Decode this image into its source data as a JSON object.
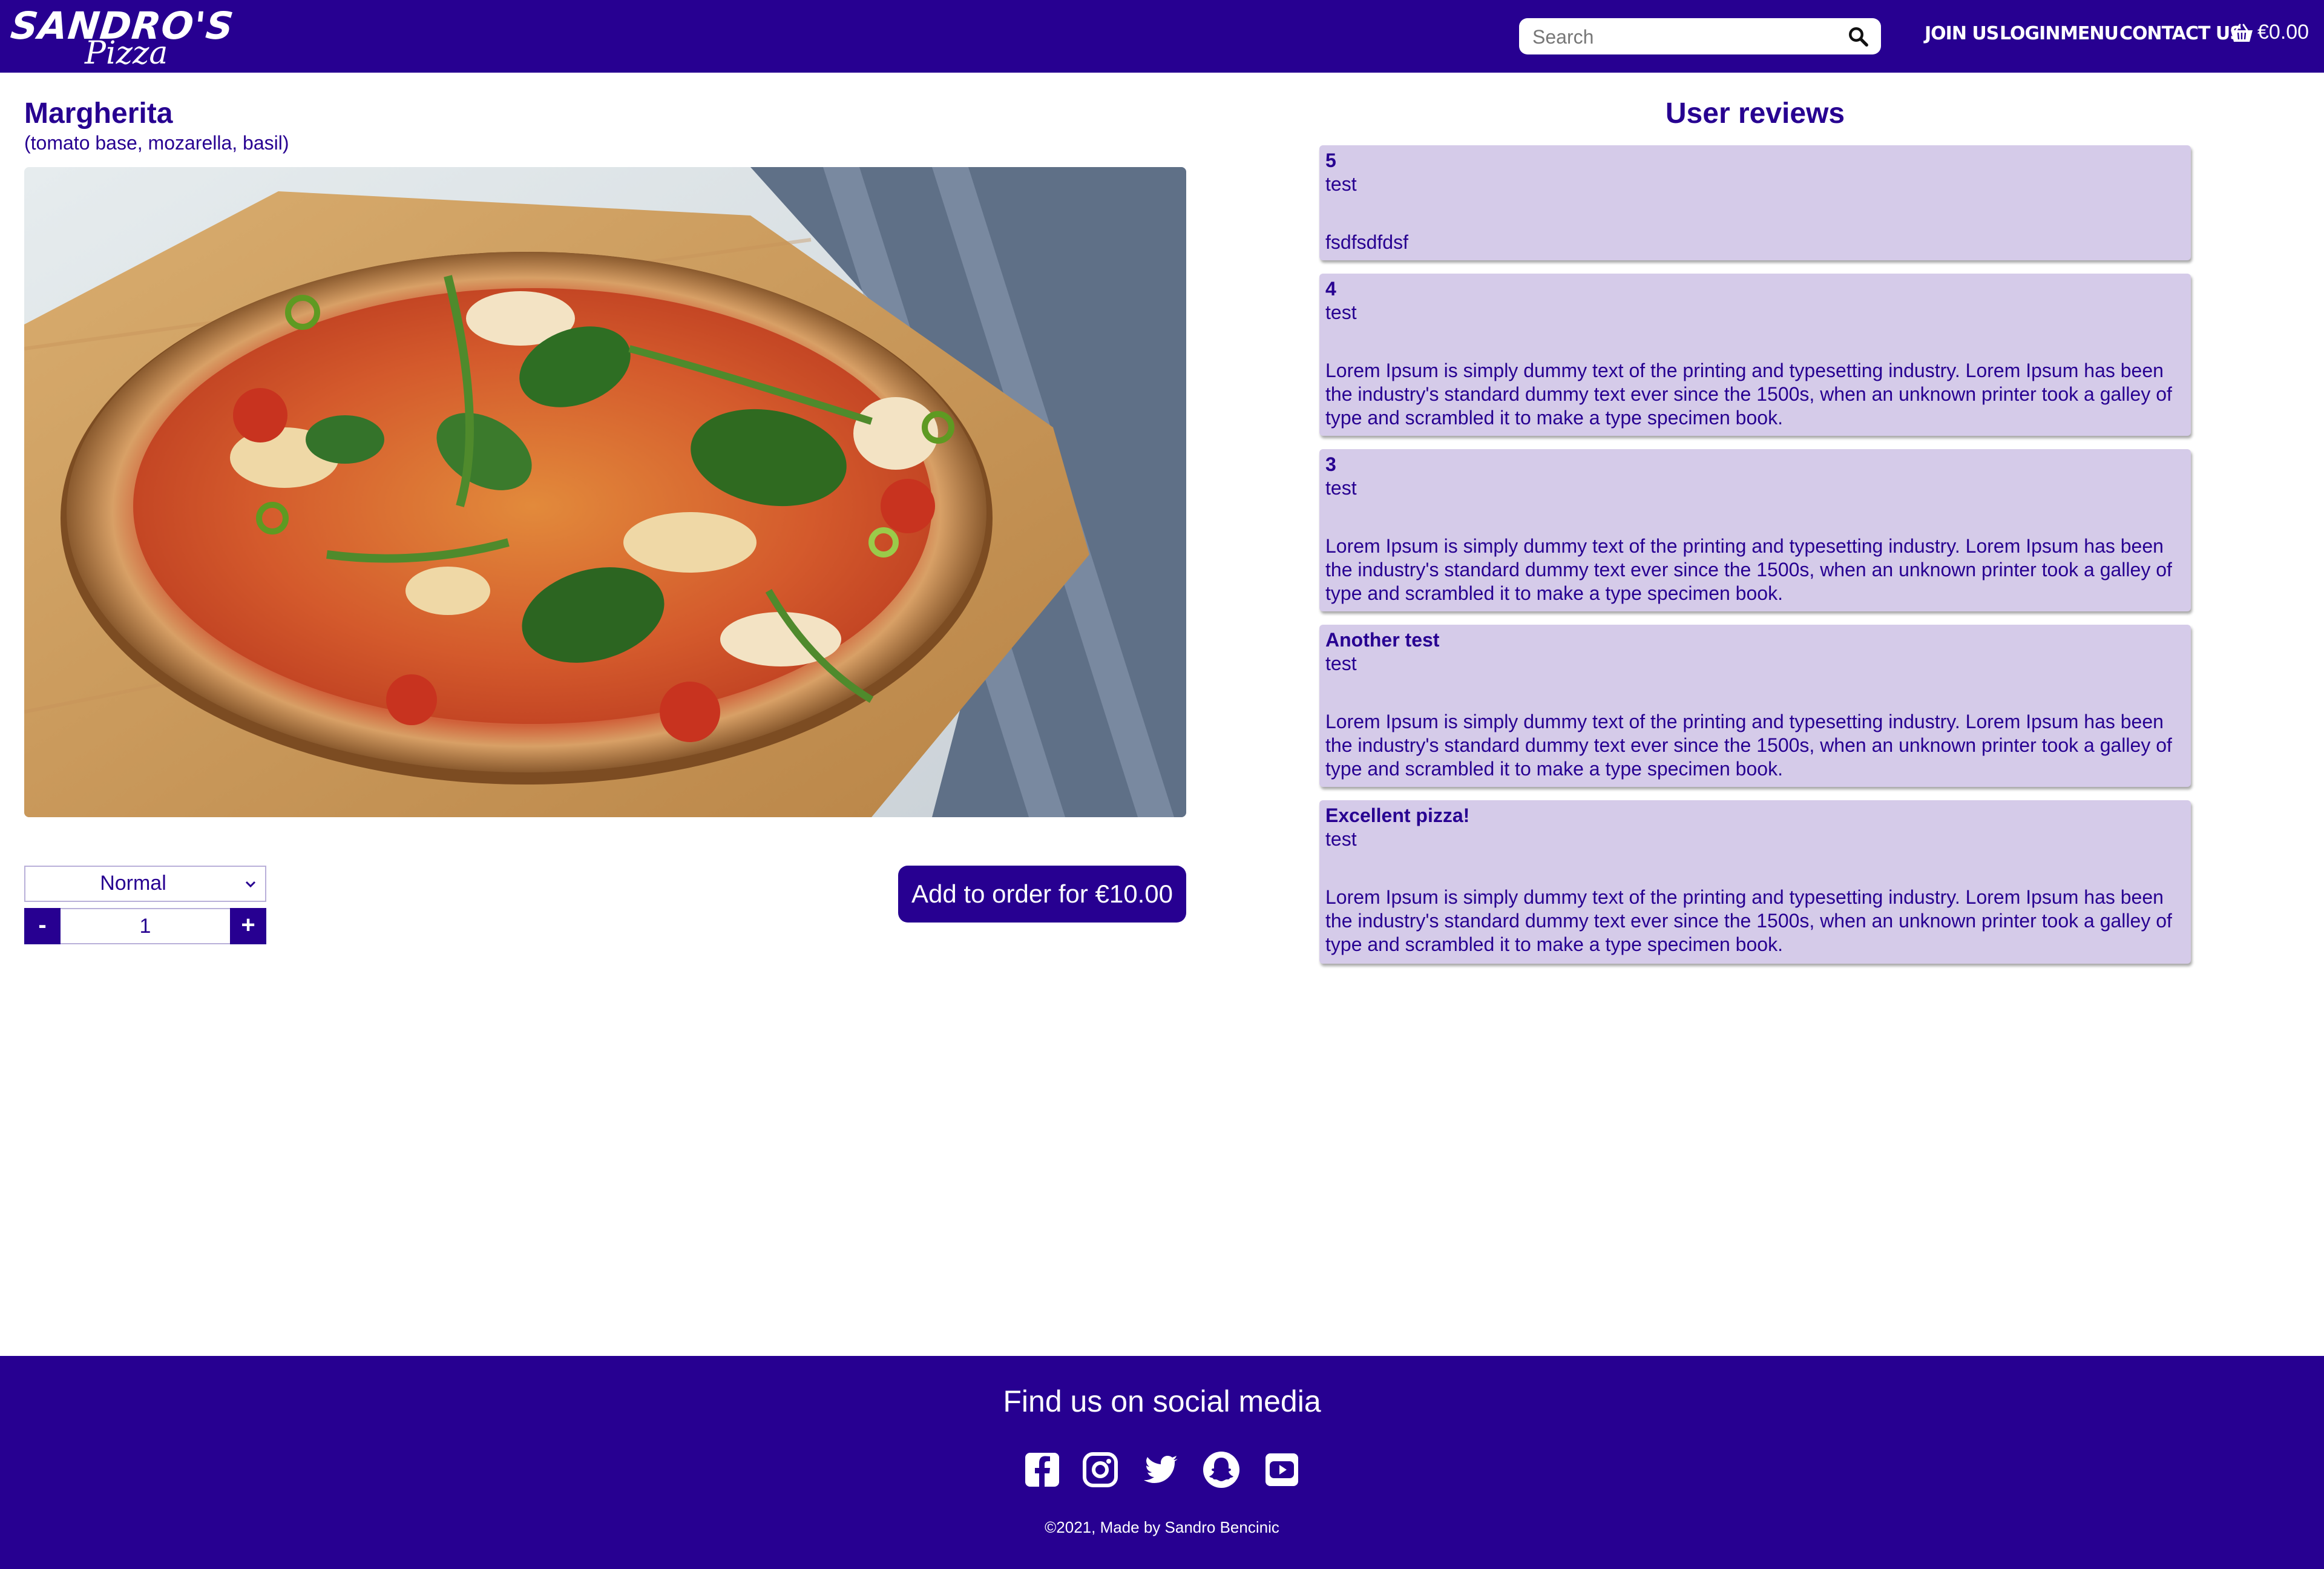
{
  "header": {
    "logo_top": "SANDRO'S",
    "logo_bottom": "Pizza",
    "search_placeholder": "Search",
    "nav": [
      "JOIN US",
      "LOGIN",
      "MENU",
      "CONTACT US"
    ],
    "cart_total": "€0.00",
    "icons": {
      "search": "search-icon",
      "cart": "basket-icon"
    }
  },
  "product": {
    "title": "Margherita",
    "ingredients": "(tomato base, mozarella, basil)",
    "size_selected": "Normal",
    "quantity": "1",
    "decrement_label": "-",
    "increment_label": "+",
    "add_button": "Add to order for €10.00"
  },
  "reviews": {
    "title": "User reviews",
    "items": [
      {
        "name": "5",
        "subtitle": "test",
        "text": "fsdfsdfdsf"
      },
      {
        "name": "4",
        "subtitle": "test",
        "text": "Lorem Ipsum is simply dummy text of the printing and typesetting industry. Lorem Ipsum has been the industry's standard dummy text ever since the 1500s, when an unknown printer took a galley of type and scrambled it to make a type specimen book."
      },
      {
        "name": "3",
        "subtitle": "test",
        "text": "Lorem Ipsum is simply dummy text of the printing and typesetting industry. Lorem Ipsum has been the industry's standard dummy text ever since the 1500s, when an unknown printer took a galley of type and scrambled it to make a type specimen book."
      },
      {
        "name": "Another test",
        "subtitle": "test",
        "text": "Lorem Ipsum is simply dummy text of the printing and typesetting industry. Lorem Ipsum has been the industry's standard dummy text ever since the 1500s, when an unknown printer took a galley of type and scrambled it to make a type specimen book."
      },
      {
        "name": "Excellent pizza!",
        "subtitle": "test",
        "text": "Lorem Ipsum is simply dummy text of the printing and typesetting industry. Lorem Ipsum has been the industry's standard dummy text ever since the 1500s, when an unknown printer took a galley of type and scrambled it to make a type specimen book."
      }
    ]
  },
  "footer": {
    "title": "Find us on social media",
    "socials": [
      "facebook-icon",
      "instagram-icon",
      "twitter-icon",
      "snapchat-icon",
      "youtube-icon"
    ],
    "copyright": "©2021, Made by Sandro Bencinic"
  },
  "colors": {
    "brand": "#270091",
    "review_bg": "#d5cbe9",
    "white": "#ffffff"
  }
}
